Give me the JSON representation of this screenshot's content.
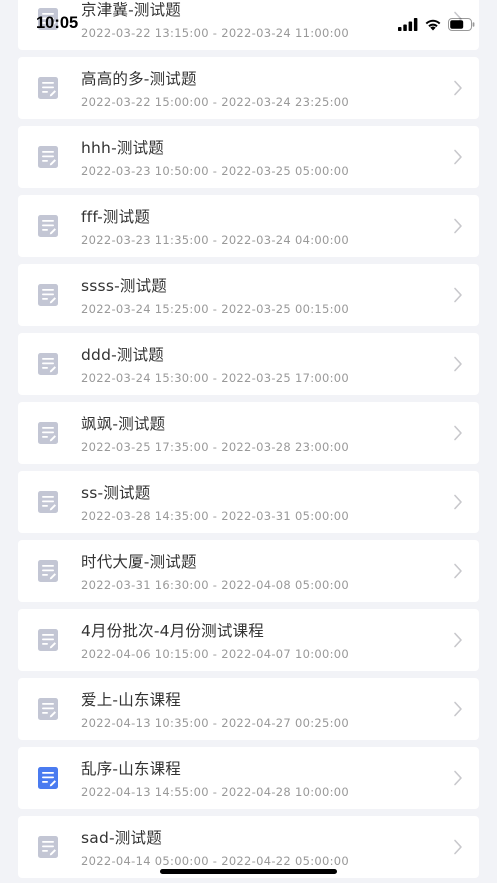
{
  "status_bar": {
    "time": "10:05",
    "icons": [
      "signal-icon",
      "wifi-icon",
      "battery-icon"
    ]
  },
  "courses": [
    {
      "title": "京津冀-测试题",
      "time": "2022-03-22 13:15:00 - 2022-03-24 11:00:00",
      "active": false
    },
    {
      "title": "高高的多-测试题",
      "time": "2022-03-22 15:00:00 - 2022-03-24 23:25:00",
      "active": false
    },
    {
      "title": "hhh-测试题",
      "time": "2022-03-23 10:50:00 - 2022-03-25 05:00:00",
      "active": false
    },
    {
      "title": "fff-测试题",
      "time": "2022-03-23 11:35:00 - 2022-03-24 04:00:00",
      "active": false
    },
    {
      "title": "ssss-测试题",
      "time": "2022-03-24 15:25:00 - 2022-03-25 00:15:00",
      "active": false
    },
    {
      "title": "ddd-测试题",
      "time": "2022-03-24 15:30:00 - 2022-03-25 17:00:00",
      "active": false
    },
    {
      "title": "飒飒-测试题",
      "time": "2022-03-25 17:35:00 - 2022-03-28 23:00:00",
      "active": false
    },
    {
      "title": "ss-测试题",
      "time": "2022-03-28 14:35:00 - 2022-03-31 05:00:00",
      "active": false
    },
    {
      "title": "时代大厦-测试题",
      "time": "2022-03-31 16:30:00 - 2022-04-08 05:00:00",
      "active": false
    },
    {
      "title": "4月份批次-4月份测试课程",
      "time": "2022-04-06 10:15:00 - 2022-04-07 10:00:00",
      "active": false
    },
    {
      "title": "爱上-山东课程",
      "time": "2022-04-13 10:35:00 - 2022-04-27 00:25:00",
      "active": false
    },
    {
      "title": "乱序-山东课程",
      "time": "2022-04-13 14:55:00 - 2022-04-28 10:00:00",
      "active": true
    },
    {
      "title": "sad-测试题",
      "time": "2022-04-14 05:00:00 - 2022-04-22 05:00:00",
      "active": false
    }
  ],
  "colors": {
    "icon_inactive": "#c3c6d4",
    "icon_active": "#4a7bf0",
    "chevron": "#c8c8cc",
    "background": "#f2f3f7"
  }
}
